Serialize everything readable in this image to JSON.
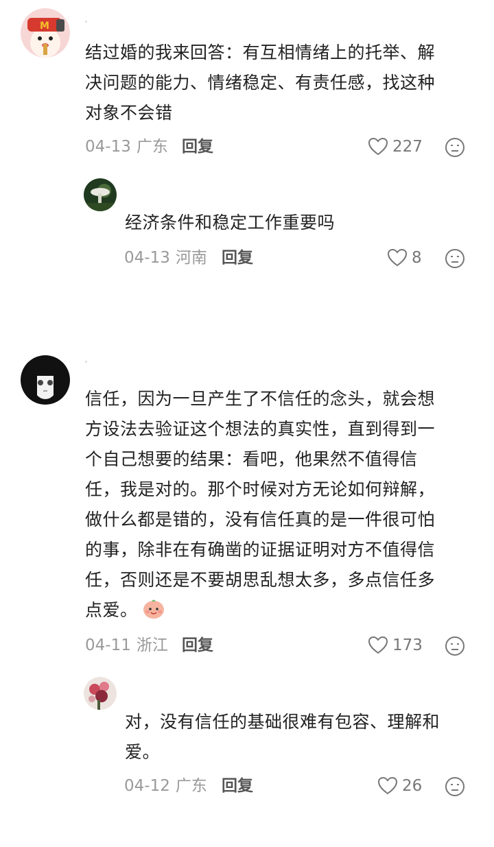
{
  "comments": [
    {
      "avatar": "clown-mcdonalds-avatar",
      "text": "结过婚的我来回答：有互相情绪上的托举、解决问题的能力、情绪稳定、有责任感，找这种对象不会错",
      "text_lines": [
        "结过婚的我来回答：有互相情绪上的托举、解",
        "决问题的能力、情绪稳定、有责任感，找这种",
        "对象不会错"
      ],
      "date": "04-13",
      "location": "广东",
      "reply_label": "回复",
      "likes": "227",
      "reply": {
        "avatar": "mushroom-avatar",
        "text": "经济条件和稳定工作重要吗",
        "date": "04-13",
        "location": "河南",
        "reply_label": "回复",
        "likes": "8"
      }
    },
    {
      "avatar": "anime-girl-avatar",
      "text_lines": [
        "信任，因为一旦产生了不信任的念头，就会想",
        "方设法去验证这个想法的真实性，直到得到一",
        "个自己想要的结果：看吧，他果然不值得信",
        "任，我是对的。那个时候对方无论如何辩解，",
        "做什么都是错的，没有信任真的是一件很可怕",
        "的事，除非在有确凿的证据证明对方不值得信",
        "任，否则还是不要胡思乱想太多，多点信任多",
        "点爱。"
      ],
      "emoji": "smiling-peach-emoji",
      "date": "04-11",
      "location": "浙江",
      "reply_label": "回复",
      "likes": "173",
      "reply": {
        "avatar": "flowers-avatar",
        "text_lines": [
          "对，没有信任的基础很难有包容、理解和",
          "爱。"
        ],
        "date": "04-12",
        "location": "广东",
        "reply_label": "回复",
        "likes": "26"
      }
    }
  ],
  "colors": {
    "text": "#222222",
    "meta": "#999999",
    "reply_label": "#555555",
    "icon": "#777777"
  }
}
